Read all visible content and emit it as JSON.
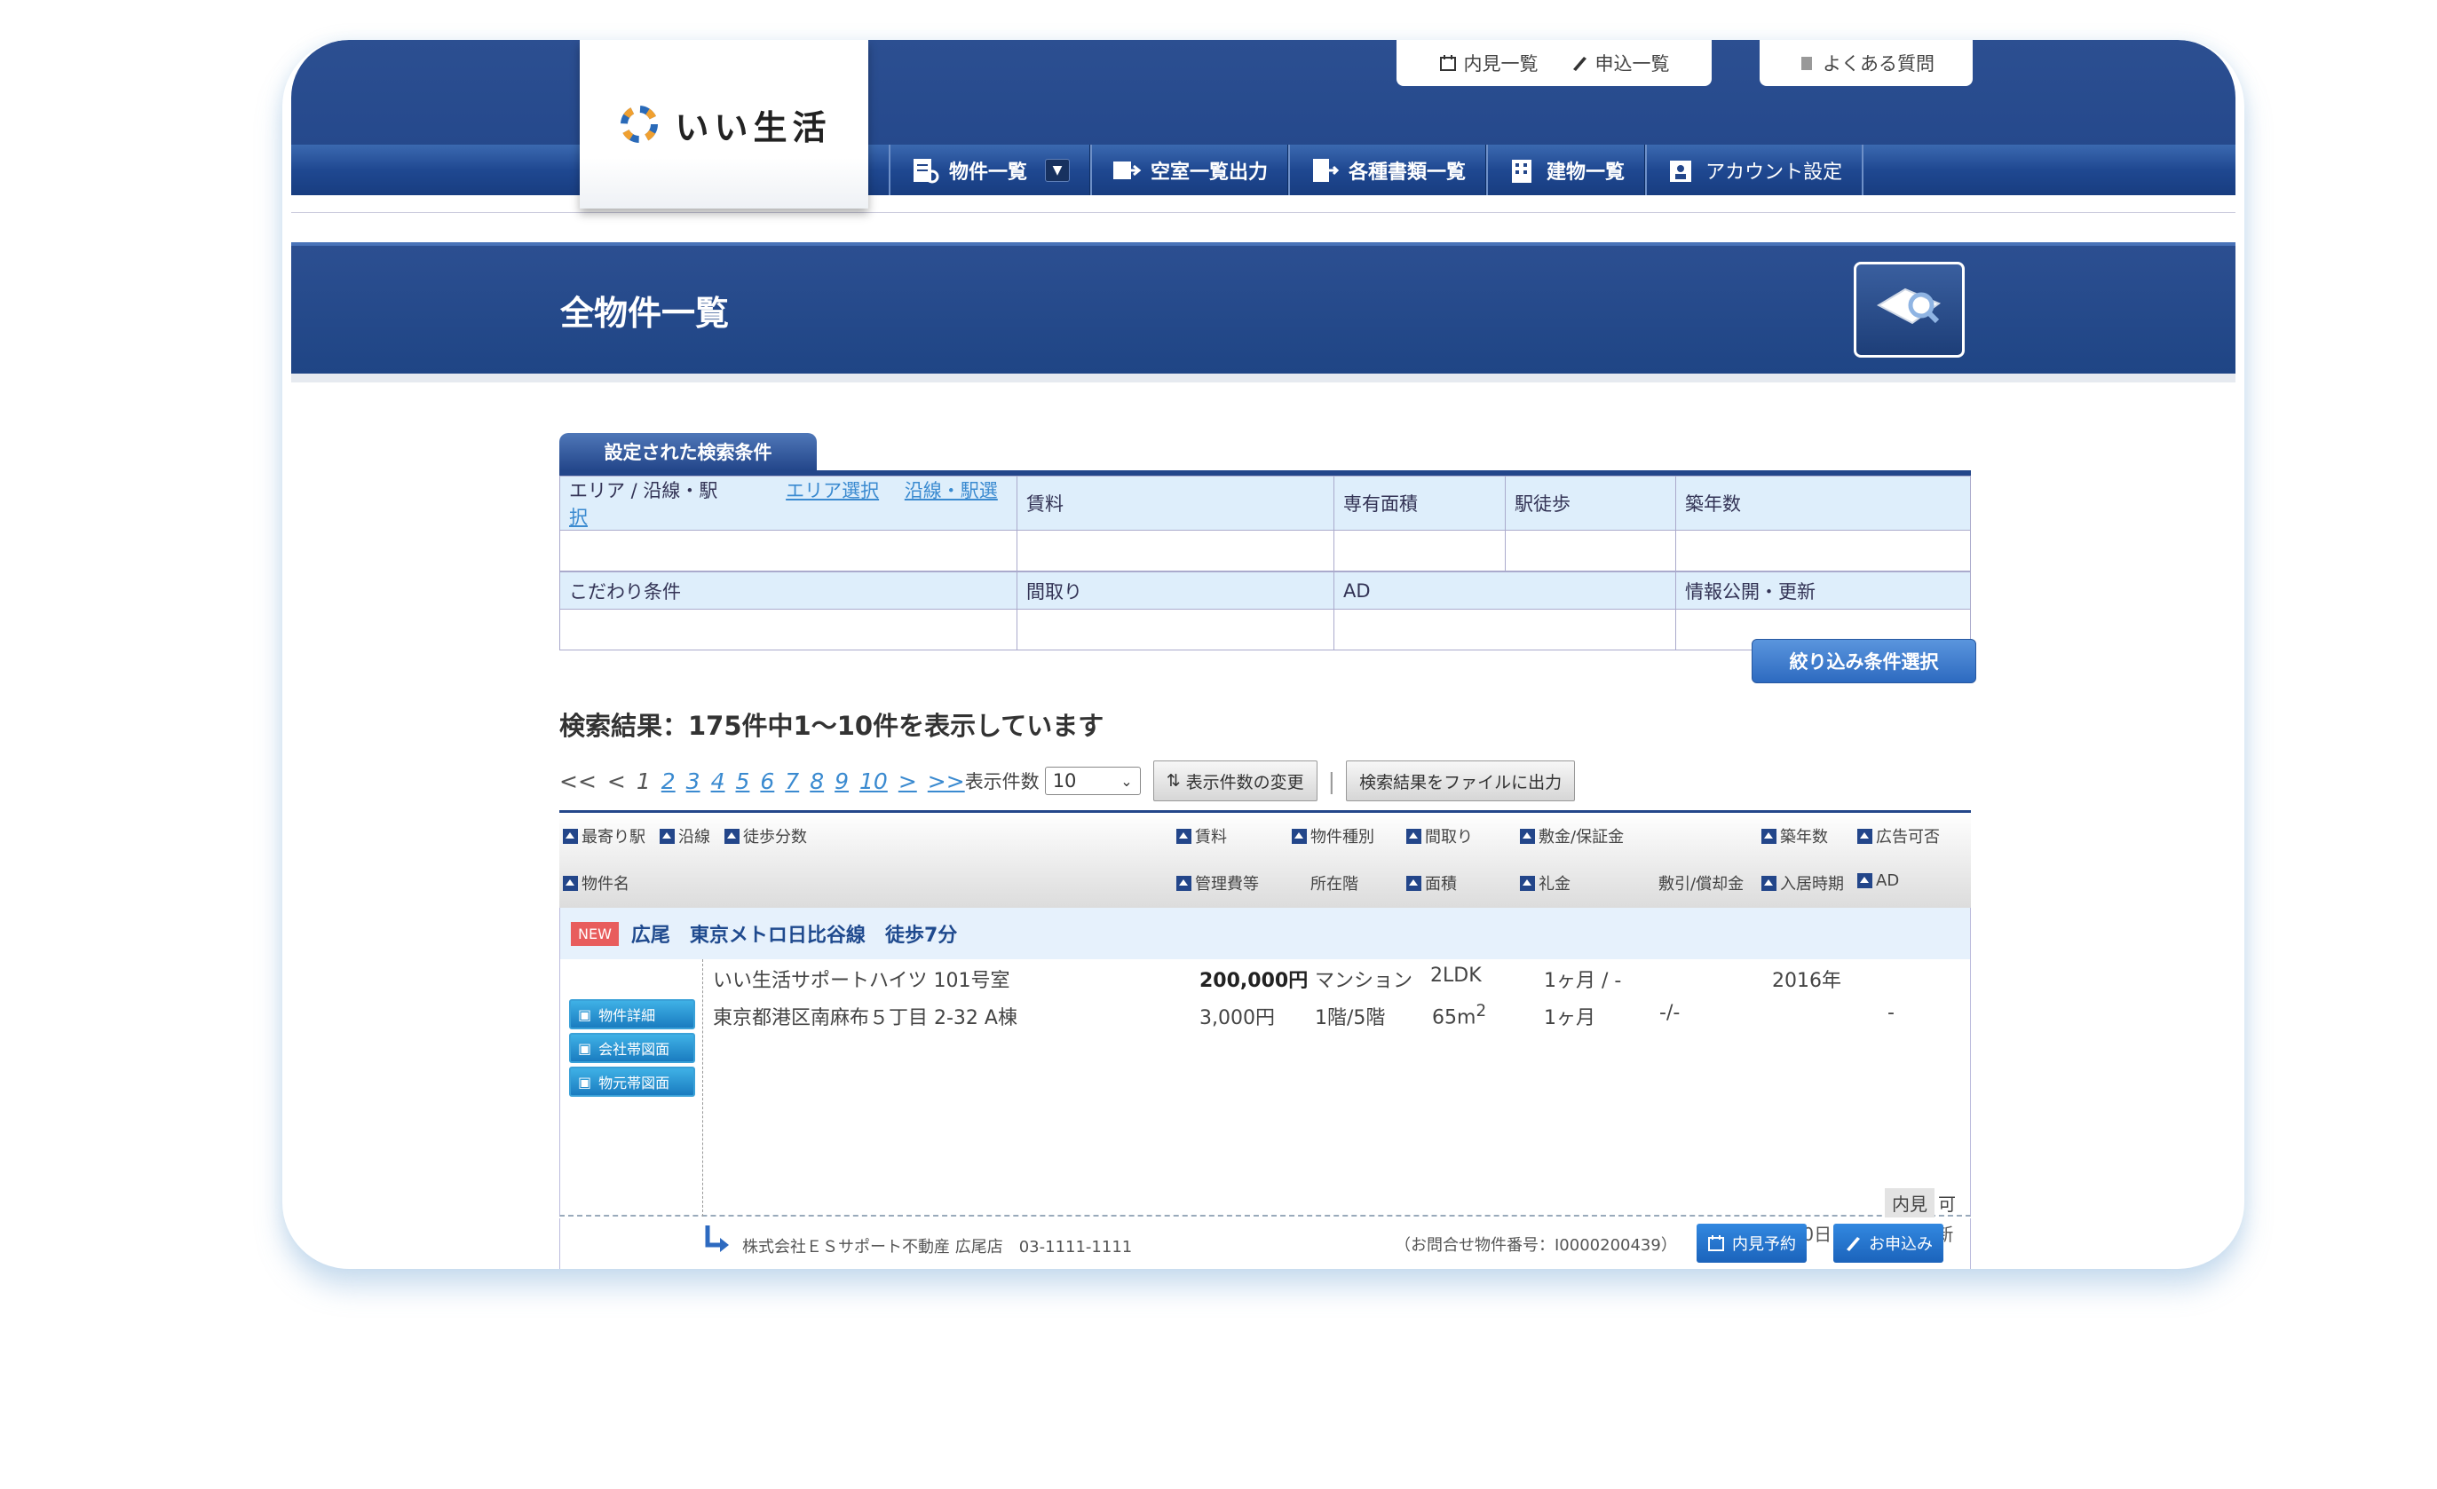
{
  "brand": {
    "name": "いい生活"
  },
  "top_tabs": [
    {
      "items": [
        {
          "label": "内見一覧",
          "icon": "calendar-icon"
        },
        {
          "label": "申込一覧",
          "icon": "pen-icon"
        }
      ]
    },
    {
      "items": [
        {
          "label": "よくある質問",
          "icon": "document-icon"
        }
      ]
    }
  ],
  "nav": [
    {
      "label": "物件一覧",
      "icon": "property-list-icon"
    },
    {
      "label": "空室一覧出力",
      "icon": "export-icon"
    },
    {
      "label": "各種書類一覧",
      "icon": "documents-icon"
    },
    {
      "label": "建物一覧",
      "icon": "building-icon"
    },
    {
      "label": "アカウント設定",
      "icon": "account-icon"
    }
  ],
  "page": {
    "title": "全物件一覧",
    "icon": "map-search-icon"
  },
  "conditions": {
    "tab": "設定された検索条件",
    "area_label": "エリア / 沿線・駅",
    "area_link": "エリア選択",
    "station_link": "沿線・駅選択",
    "rent": "賃料",
    "floor_area": "専有面積",
    "walk": "駅徒歩",
    "age": "築年数",
    "preference": "こだわり条件",
    "layout": "間取り",
    "ad": "AD",
    "publish": "情報公開・更新",
    "filter_button": "絞り込み条件選択"
  },
  "result": {
    "summary": "検索結果：175件中1～10件を表示しています"
  },
  "pager": {
    "first": "<<",
    "prev": "<",
    "pages": [
      "1",
      "2",
      "3",
      "4",
      "5",
      "6",
      "7",
      "8",
      "9",
      "10"
    ],
    "next": ">",
    "last": ">>",
    "per_page_label": "表示件数",
    "per_page_value": "10",
    "change_button": "表示件数の変更",
    "export_button": "検索結果をファイルに出力"
  },
  "grid_headers": {
    "nearest_station": "最寄り駅",
    "line": "沿線",
    "walk_min": "徒歩分数",
    "rent": "賃料",
    "type": "物件種別",
    "layout": "間取り",
    "deposit": "敷金/保証金",
    "age": "築年数",
    "ad_ok": "広告可否",
    "name": "物件名",
    "mgmt_fee": "管理費等",
    "floor": "所在階",
    "area": "面積",
    "key_money": "礼金",
    "deduction": "敷引/償却金",
    "move_in": "入居時期",
    "ad": "AD"
  },
  "listing": {
    "new_badge": "NEW",
    "station": "広尾",
    "line": "東京メトロ日比谷線",
    "walk": "徒歩7分",
    "name": "いい生活サポートハイツ 101号室",
    "address": "東京都港区南麻布５丁目 2-32 A棟",
    "rent": "200,000円",
    "type": "マンション",
    "layout": "2LDK",
    "deposit": "1ヶ月 / -",
    "built": "2016年",
    "mgmt_fee": "3,000円",
    "floor": "1階/5階",
    "area": "65m",
    "area_sup": "2",
    "key_money": "1ヶ月",
    "deduction": "-/-",
    "ad": "-",
    "buttons": [
      "物件詳細",
      "会社帯図面",
      "物元帯図面"
    ],
    "viewing_label": "内見",
    "viewing_value": "可",
    "updated": "2023年6月20日 19時41分更新"
  },
  "footer": {
    "company": "株式会社ＥＳサポート不動産 広尾店　03-1111-1111",
    "inquiry": "（お問合せ物件番号：I0000200439）",
    "viewing_button": "内見予約",
    "apply_button": "お申込み"
  },
  "colors": {
    "navy": "#23468a",
    "accent": "#2d6ac0",
    "new_badge": "#e85d5d"
  }
}
